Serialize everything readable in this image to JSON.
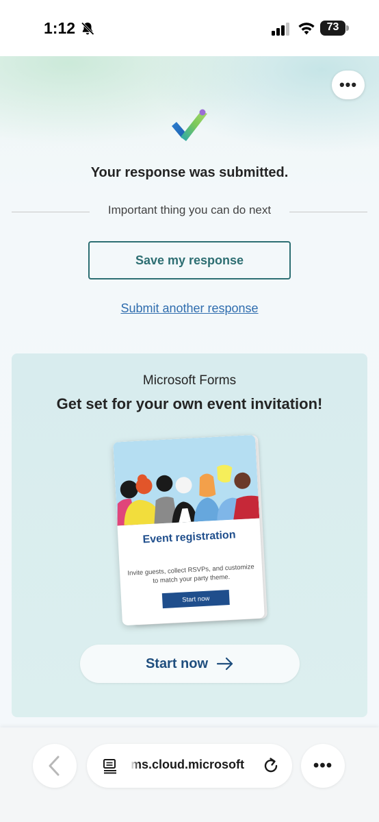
{
  "status_bar": {
    "time": "1:12",
    "battery": "73"
  },
  "page": {
    "submitted_text": "Your response was submitted.",
    "next_label": "Important thing you can do next",
    "save_button": "Save my response",
    "another_link": "Submit another response",
    "more_button": "•••"
  },
  "promo": {
    "brand": "Microsoft Forms",
    "title": "Get set for your own event invitation!",
    "card": {
      "title": "Event registration",
      "description": "Invite guests, collect RSVPs, and customize to match your party theme.",
      "button": "Start now"
    },
    "start_button": "Start now"
  },
  "browser": {
    "url": "ms.cloud.microsoft",
    "menu_button": "•••"
  },
  "colors": {
    "accent_teal": "#2d6e72",
    "link_blue": "#2f6dae",
    "event_blue": "#1f4e8c"
  }
}
